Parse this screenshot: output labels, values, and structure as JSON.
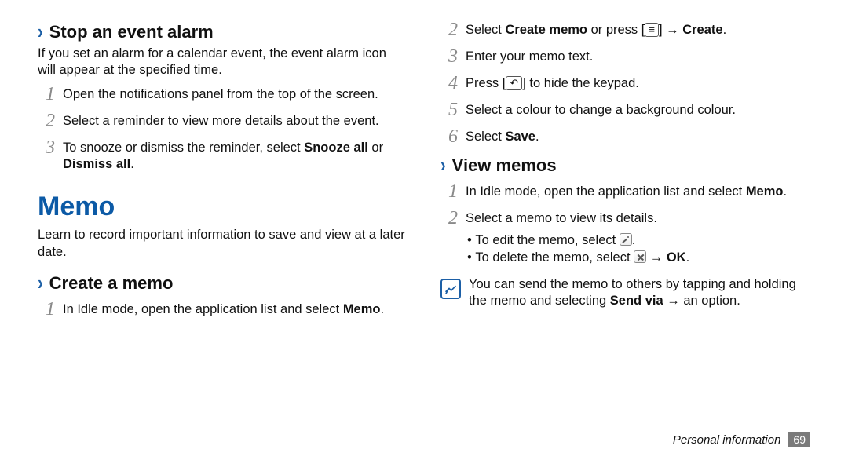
{
  "left": {
    "stopAlarm": {
      "heading": "Stop an event alarm",
      "intro": "If you set an alarm for a calendar event, the event alarm icon will appear at the specified time.",
      "steps": [
        {
          "n": "1",
          "text": "Open the notifications panel from the top of the screen."
        },
        {
          "n": "2",
          "text": "Select a reminder to view more details about the event."
        },
        {
          "n": "3",
          "prefix": "To snooze or dismiss the reminder, select ",
          "bold1": "Snooze all",
          "mid": " or ",
          "bold2": "Dismiss all",
          "suffix": "."
        }
      ]
    },
    "memoHeader": "Memo",
    "memoIntro": "Learn to record important information to save and view at a later date.",
    "createMemo": {
      "heading": "Create a memo",
      "step1": {
        "n": "1",
        "prefix": "In Idle mode, open the application list and select ",
        "bold": "Memo",
        "suffix": "."
      }
    }
  },
  "right": {
    "createCont": [
      {
        "n": "2",
        "prefix": "Select ",
        "bold1": "Create memo",
        "mid": " or press [",
        "key": "≡",
        "mid2": "] → ",
        "bold2": "Create",
        "suffix": "."
      },
      {
        "n": "3",
        "text": "Enter your memo text."
      },
      {
        "n": "4",
        "prefix": "Press [",
        "key": "↶",
        "mid": "] to hide the keypad."
      },
      {
        "n": "5",
        "text": "Select a colour to change a background colour."
      },
      {
        "n": "6",
        "prefix": "Select ",
        "bold": "Save",
        "suffix": "."
      }
    ],
    "viewMemos": {
      "heading": "View memos",
      "step1": {
        "n": "1",
        "prefix": "In Idle mode, open the application list and select ",
        "bold": "Memo",
        "suffix": "."
      },
      "step2": {
        "n": "2",
        "text": "Select a memo to view its details.",
        "bullets": {
          "b1": {
            "prefix": "To edit the memo, select ",
            "suffix": "."
          },
          "b2": {
            "prefix": "To delete the memo, select ",
            "mid": " → ",
            "bold": "OK",
            "suffix": "."
          }
        }
      },
      "note": {
        "prefix": "You can send the memo to others by tapping and holding the memo and selecting ",
        "bold": "Send via",
        "mid": " → an option."
      }
    }
  },
  "footer": {
    "section": "Personal information",
    "page": "69"
  }
}
